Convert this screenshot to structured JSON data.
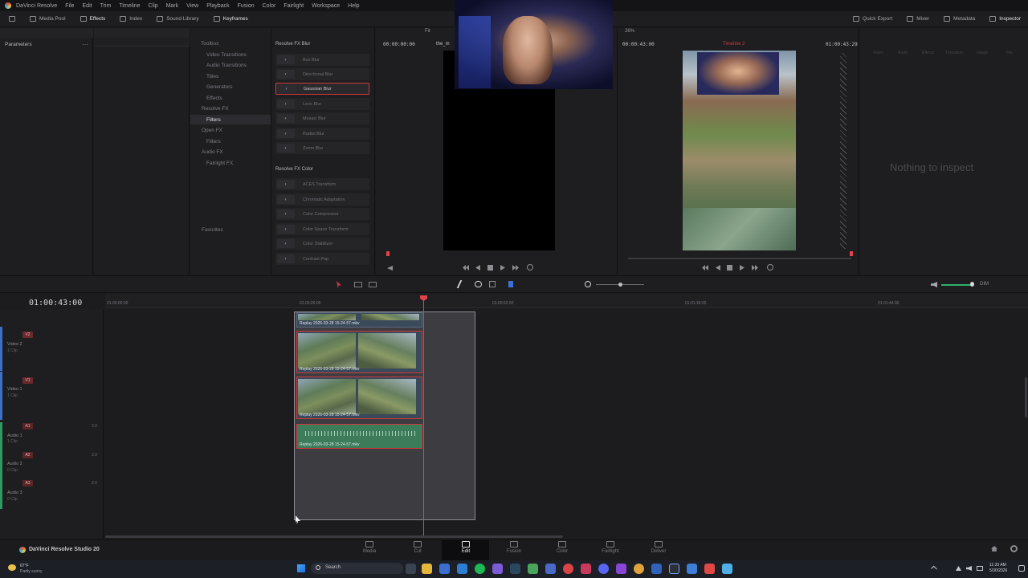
{
  "menu": [
    "DaVinci Resolve",
    "File",
    "Edit",
    "Trim",
    "Timeline",
    "Clip",
    "Mark",
    "View",
    "Playback",
    "Fusion",
    "Color",
    "Fairlight",
    "Workspace",
    "Help"
  ],
  "toolbar": {
    "left": [
      {
        "label": "Media Pool",
        "icon": "media-pool-icon"
      },
      {
        "label": "Effects",
        "icon": "effects-icon",
        "active": true
      },
      {
        "label": "Index",
        "icon": "index-icon"
      },
      {
        "label": "Sound Library",
        "icon": "sound-library-icon"
      },
      {
        "label": "Keyframes",
        "icon": "keyframes-icon",
        "active": true
      }
    ],
    "right": [
      {
        "label": "Quick Export",
        "icon": "export-icon"
      },
      {
        "label": "Mixer",
        "icon": "mixer-icon"
      },
      {
        "label": "Metadata",
        "icon": "metadata-icon"
      },
      {
        "label": "Inspector",
        "icon": "inspector-icon",
        "active": true
      }
    ]
  },
  "parameters": {
    "title": "Parameters"
  },
  "effects": {
    "tree": [
      "Toolbox",
      "Video Transitions",
      "Audio Transitions",
      "Titles",
      "Generators",
      "Effects",
      "Resolve FX",
      "Filters",
      "Open FX",
      "Filters",
      "Audio FX",
      "Fairlight FX"
    ],
    "favorites": "Favorites",
    "blur_header": "Resolve FX Blur",
    "blur_items": [
      "Box Blur",
      "Directional Blur",
      "Gaussian Blur",
      "Lens Blur",
      "Mosaic Blur",
      "Radial Blur",
      "Zoom Blur"
    ],
    "color_header": "Resolve FX Color",
    "color_items": [
      "ACES Transform",
      "Chromatic Adaptation",
      "Color Compressor",
      "Color Space Transform",
      "Color Stabilizer",
      "Contrast Pop"
    ]
  },
  "source_viewer": {
    "fit": "Fit",
    "timecode": "00:00:00:00",
    "clip_name": "the_m"
  },
  "timeline_viewer": {
    "zoom": "26%",
    "timecode": "00:00:43:00",
    "name": "Timeline 2",
    "right_timecode": "01:00:43:29"
  },
  "inspector": {
    "empty_text": "Nothing to inspect",
    "tabs": [
      "Video",
      "Audio",
      "Effects",
      "Transition",
      "Image",
      "File"
    ]
  },
  "timeline": {
    "timecode": "01:00:43:00",
    "ruler": [
      "01:00:00:00",
      "01:00:26:00",
      "01:00:52:00",
      "01:01:18:00",
      "01:01:44:00"
    ],
    "tracks": [
      {
        "badge": "V2",
        "name": "Video 2",
        "sub": "1 Clip"
      },
      {
        "badge": "V1",
        "name": "Video 1",
        "sub": "1 Clip"
      },
      {
        "badge": "A1",
        "name": "Audio 1",
        "sub": "1 Clip",
        "level": "2.0"
      },
      {
        "badge": "A2",
        "name": "Audio 2",
        "sub": "0 Clip",
        "level": "2.0"
      },
      {
        "badge": "A3",
        "name": "Audio 3",
        "sub": "0 Clip",
        "level": "2.0"
      }
    ],
    "clip_label": "Replay 2026-03-28 15-24-57.mkv",
    "dim": "DIM"
  },
  "pages": [
    {
      "label": "Media"
    },
    {
      "label": "Cut"
    },
    {
      "label": "Edit",
      "active": true
    },
    {
      "label": "Fusion"
    },
    {
      "label": "Color"
    },
    {
      "label": "Fairlight"
    },
    {
      "label": "Deliver"
    }
  ],
  "brand": "DaVinci Resolve Studio 20",
  "taskbar": {
    "weather_temp": "67°F",
    "weather_text": "Partly sunny",
    "search": "Search",
    "time": "11:33 AM",
    "date": "5/30/2026"
  },
  "colors": {
    "accent": "#d0383c",
    "playhead": "#e0434a",
    "clip_video": "#3b4a5b",
    "clip_audio": "#3d7c5a"
  }
}
